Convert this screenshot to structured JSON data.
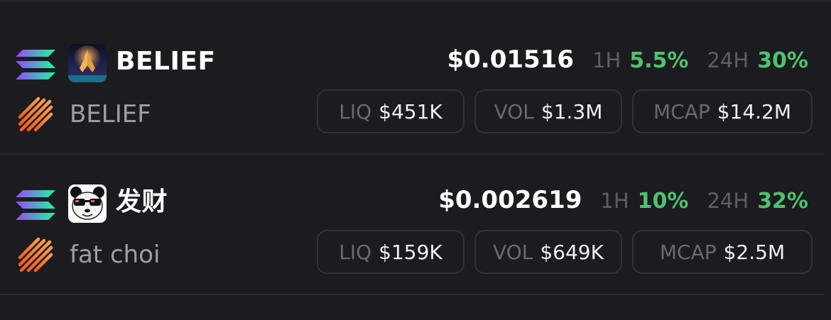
{
  "colors": {
    "background": "#1c1b1f",
    "positive": "#4cc46e",
    "muted_text": "#a09ea6",
    "pill_border": "#333238"
  },
  "tokens": [
    {
      "name": "BELIEF",
      "subname": "BELIEF",
      "avatar_icon": "praying-hands-icon",
      "chain_icon": "solana-icon",
      "dex_icon": "pump-stripes-icon",
      "price": "$0.01516",
      "change_1h_label": "1H",
      "change_1h": "5.5%",
      "change_24h_label": "24H",
      "change_24h": "30%",
      "liq_label": "LIQ",
      "liq": "$451K",
      "vol_label": "VOL",
      "vol": "$1.3M",
      "mcap_label": "MCAP",
      "mcap": "$14.2M"
    },
    {
      "name": "发财",
      "subname": "fat choi",
      "avatar_icon": "panda-sunglasses-icon",
      "chain_icon": "solana-icon",
      "dex_icon": "pump-stripes-icon",
      "price": "$0.002619",
      "change_1h_label": "1H",
      "change_1h": "10%",
      "change_24h_label": "24H",
      "change_24h": "32%",
      "liq_label": "LIQ",
      "liq": "$159K",
      "vol_label": "VOL",
      "vol": "$649K",
      "mcap_label": "MCAP",
      "mcap": "$2.5M"
    }
  ]
}
